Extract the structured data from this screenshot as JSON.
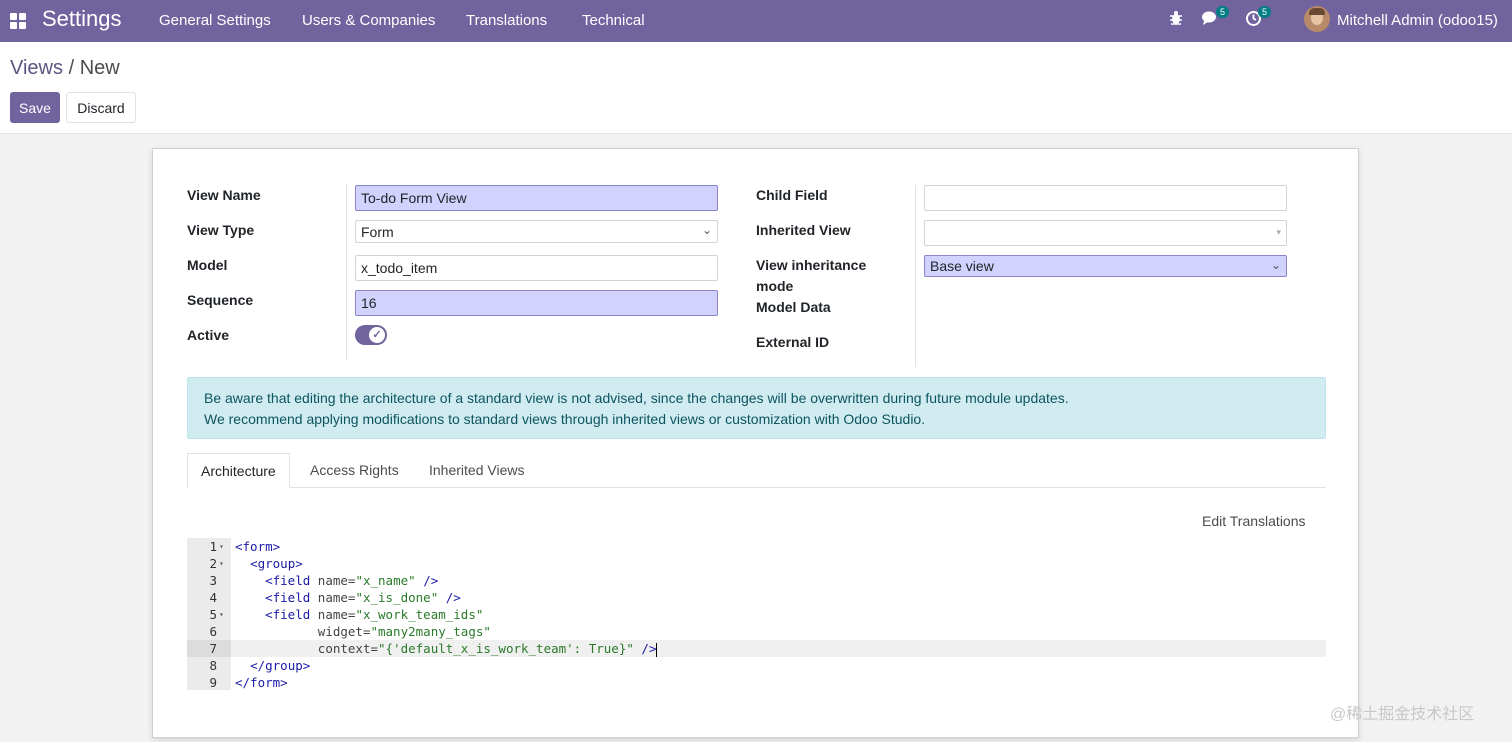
{
  "navbar": {
    "app_title": "Settings",
    "menu": [
      "General Settings",
      "Users & Companies",
      "Translations",
      "Technical"
    ],
    "messages_count": "5",
    "activities_count": "5",
    "user_name": "Mitchell Admin (odoo15)"
  },
  "breadcrumb": {
    "parent": "Views",
    "current": "New"
  },
  "buttons": {
    "save": "Save",
    "discard": "Discard"
  },
  "form": {
    "left": [
      {
        "label": "View Name",
        "value": "To-do Form View"
      },
      {
        "label": "View Type",
        "value": "Form"
      },
      {
        "label": "Model",
        "value": "x_todo_item"
      },
      {
        "label": "Sequence",
        "value": "16"
      },
      {
        "label": "Active",
        "value": ""
      }
    ],
    "active": true,
    "right": {
      "child_field_label": "Child Field",
      "child_field_value": "",
      "inherited_view_label": "Inherited View",
      "inherited_view_value": "",
      "inheritance_mode_label_1": "View inheritance",
      "inheritance_mode_label_2": "mode",
      "inheritance_mode_value": "Base view",
      "model_data_label": "Model Data",
      "external_id_label": "External ID"
    }
  },
  "alert": {
    "line1": "Be aware that editing the architecture of a standard view is not advised, since the changes will be overwritten during future module updates.",
    "line2": "We recommend applying modifications to standard views through inherited views or customization with Odoo Studio."
  },
  "tabs": [
    "Architecture",
    "Access Rights",
    "Inherited Views"
  ],
  "active_tab": "Architecture",
  "edit_translations": "Edit Translations",
  "code": {
    "line_numbers": [
      "1",
      "2",
      "3",
      "4",
      "5",
      "6",
      "7",
      "8",
      "9"
    ],
    "current_line": 7,
    "lines": {
      "l1": "<form>",
      "l2": "<group>",
      "l3_tag": "<field",
      "l3_attr": "name=",
      "l3_val": "\"x_name\"",
      "l3_end": "/>",
      "l4_tag": "<field",
      "l4_attr": "name=",
      "l4_val": "\"x_is_done\"",
      "l4_end": "/>",
      "l5_tag": "<field",
      "l5_attr": "name=",
      "l5_val": "\"x_work_team_ids\"",
      "l6_attr": "widget=",
      "l6_val": "\"many2many_tags\"",
      "l7_attr": "context=",
      "l7_val": "\"{'default_x_is_work_team': True}\"",
      "l7_end": "/>",
      "l8": "</group>",
      "l9": "</form>"
    }
  },
  "watermark": "@稀土掘金技术社区",
  "colors": {
    "brand": "#71639e",
    "required_bg": "#d2d2ff",
    "alert_bg": "#d1ecf1"
  }
}
